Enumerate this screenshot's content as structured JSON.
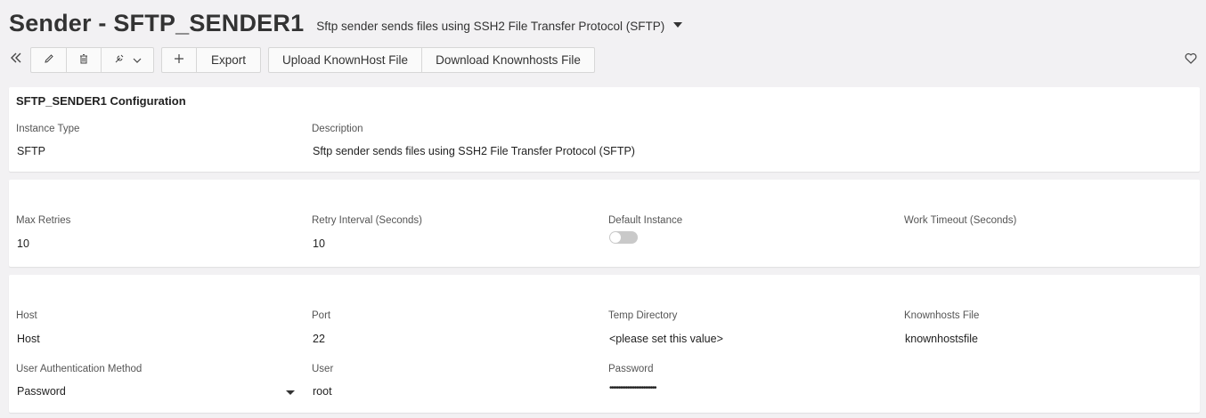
{
  "header": {
    "title": "Sender - SFTP_SENDER1",
    "subtitle": "Sftp sender sends files using SSH2 File Transfer Protocol (SFTP)"
  },
  "toolbar": {
    "collapse_icon": "double-chevron-left-icon",
    "edit_icon": "pencil-icon",
    "delete_icon": "trash-icon",
    "actions_icon": "wrench-dropdown-icon",
    "add_icon": "plus-icon",
    "export_label": "Export",
    "upload_label": "Upload KnownHost File",
    "download_label": "Download Knownhosts File",
    "favorite_icon": "heart-icon"
  },
  "config": {
    "title": "SFTP_SENDER1 Configuration",
    "instance_type_label": "Instance Type",
    "instance_type_value": "SFTP",
    "description_label": "Description",
    "description_value": "Sftp sender sends files using SSH2 File Transfer Protocol (SFTP)"
  },
  "settings": {
    "max_retries_label": "Max Retries",
    "max_retries_value": "10",
    "retry_interval_label": "Retry Interval (Seconds)",
    "retry_interval_value": "10",
    "default_instance_label": "Default Instance",
    "default_instance_on": false,
    "work_timeout_label": "Work Timeout (Seconds)",
    "work_timeout_value": ""
  },
  "connection": {
    "host_label": "Host",
    "host_value": "Host",
    "port_label": "Port",
    "port_value": "22",
    "temp_dir_label": "Temp Directory",
    "temp_dir_value": "<please set this value>",
    "knownhosts_label": "Knownhosts File",
    "knownhosts_value": "knownhostsfile",
    "auth_method_label": "User Authentication Method",
    "auth_method_value": "Password",
    "user_label": "User",
    "user_value": "root",
    "password_label": "Password",
    "password_value": "••••••••••••••••••••••••••"
  }
}
